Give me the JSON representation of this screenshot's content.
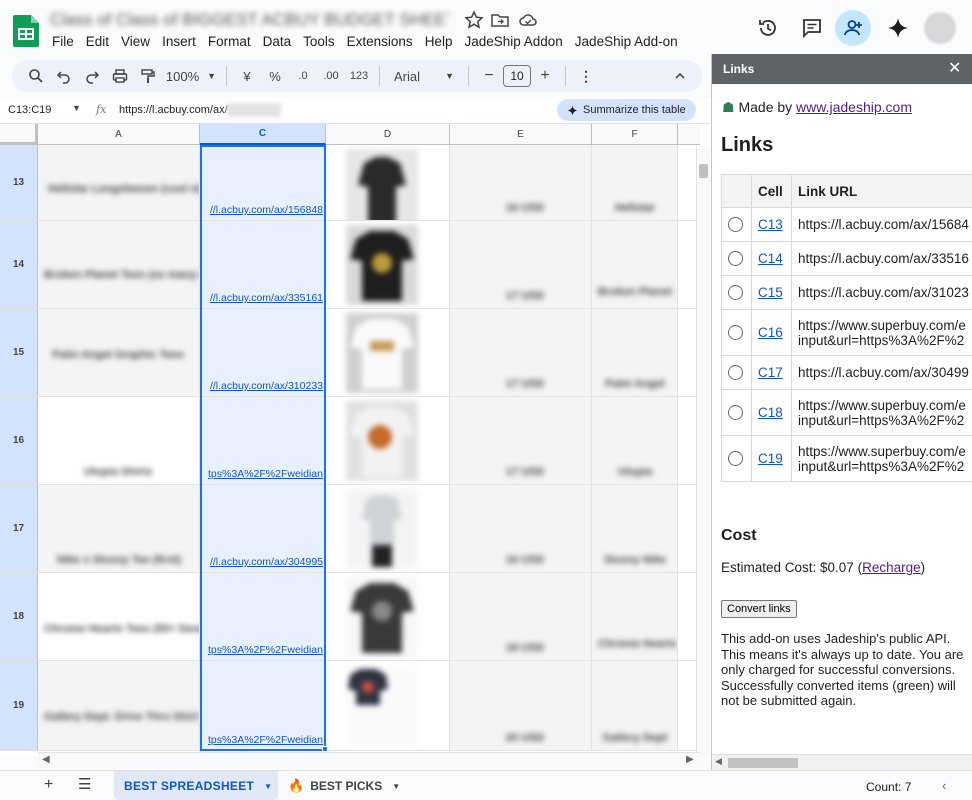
{
  "app": {
    "doc_title": "Class of Class of BIGGEST ACBUY BUDGET SHEET",
    "menu": [
      "File",
      "Edit",
      "View",
      "Insert",
      "Format",
      "Data",
      "Tools",
      "Extensions",
      "Help",
      "JadeShip Addon",
      "JadeShip Add-on"
    ]
  },
  "toolbar": {
    "zoom": "100%",
    "currency": "¥",
    "percent": "%",
    "dec_decrease": ".0",
    "dec_increase": ".00",
    "number_format": "123",
    "font": "Arial",
    "font_size": "10"
  },
  "formula_bar": {
    "namebox": "C13:C19",
    "fx": "fx",
    "formula": "https://l.acbuy.com/ax/",
    "summarize": "Summarize this table"
  },
  "grid": {
    "columns": [
      "A",
      "C",
      "D",
      "E",
      "F"
    ],
    "rows": [
      {
        "num": "13",
        "a": "Hellstar Longsleeves (cool styles)",
        "c": "//l.acbuy.com/ax/156848",
        "e": "16 USD",
        "f": "Hellstar"
      },
      {
        "num": "14",
        "a": "Broken Planet Tees (so many designs)",
        "c": "//l.acbuy.com/ax/335161",
        "e": "17 USD",
        "f": "Broken Planet"
      },
      {
        "num": "15",
        "a": "Palm Angel Graphic Tees",
        "c": "//l.acbuy.com/ax/310233",
        "e": "17 USD",
        "f": "Palm Angel"
      },
      {
        "num": "16",
        "a": "Utopia Shirts",
        "c": "tps%3A%2F%2Fweidian",
        "e": "17 USD",
        "f": "Utopia"
      },
      {
        "num": "17",
        "a": "Nike x Stussy Tee (first)",
        "c": "//l.acbuy.com/ax/304995",
        "e": "16 USD",
        "f": "Stussy Nike"
      },
      {
        "num": "18",
        "a": "Chrome Hearts Tees (50+ Designs)",
        "c": "tps%3A%2F%2Fweidian",
        "e": "18 USD",
        "f": "Chrome Hearts"
      },
      {
        "num": "19",
        "a": "Gallery Dept. Drive Thru Shirt (so fire)",
        "c": "tps%3A%2F%2Fweidian",
        "e": "20 USD",
        "f": "Gallery Dept"
      }
    ]
  },
  "sheets": {
    "tabs": [
      "BEST SPREADSHEET",
      "BEST PICKS"
    ],
    "count": "Count: 7"
  },
  "panel": {
    "title": "Links",
    "made_by_prefix": "Made by ",
    "made_by_link": "www.jadeship.com",
    "heading": "Links",
    "col_cell": "Cell",
    "col_url": "Link URL",
    "links": [
      {
        "cell": "C13",
        "url": "https://l.acbuy.com/ax/15684"
      },
      {
        "cell": "C14",
        "url": "https://l.acbuy.com/ax/33516"
      },
      {
        "cell": "C15",
        "url": "https://l.acbuy.com/ax/31023"
      },
      {
        "cell": "C16",
        "url": "https://www.superbuy.com/e",
        "url2": "input&url=https%3A%2F%2"
      },
      {
        "cell": "C17",
        "url": "https://l.acbuy.com/ax/30499"
      },
      {
        "cell": "C18",
        "url": "https://www.superbuy.com/e",
        "url2": "input&url=https%3A%2F%2"
      },
      {
        "cell": "C19",
        "url": "https://www.superbuy.com/e",
        "url2": "input&url=https%3A%2F%2"
      }
    ],
    "cost_title": "Cost",
    "cost_prefix": "Estimated Cost: $0.07 (",
    "recharge": "Recharge",
    "cost_suffix": ")",
    "convert": "Convert links",
    "info": "This add-on uses Jadeship's public API. This means it's always up to date. You are only charged for successful conversions. Successfully converted items (green) will not be submitted again."
  },
  "colors": {
    "accent": "#0b57d0",
    "selection_fill": "#e8f0fe",
    "panel_header": "#5f6368",
    "share_bg": "#c2e7ff"
  }
}
